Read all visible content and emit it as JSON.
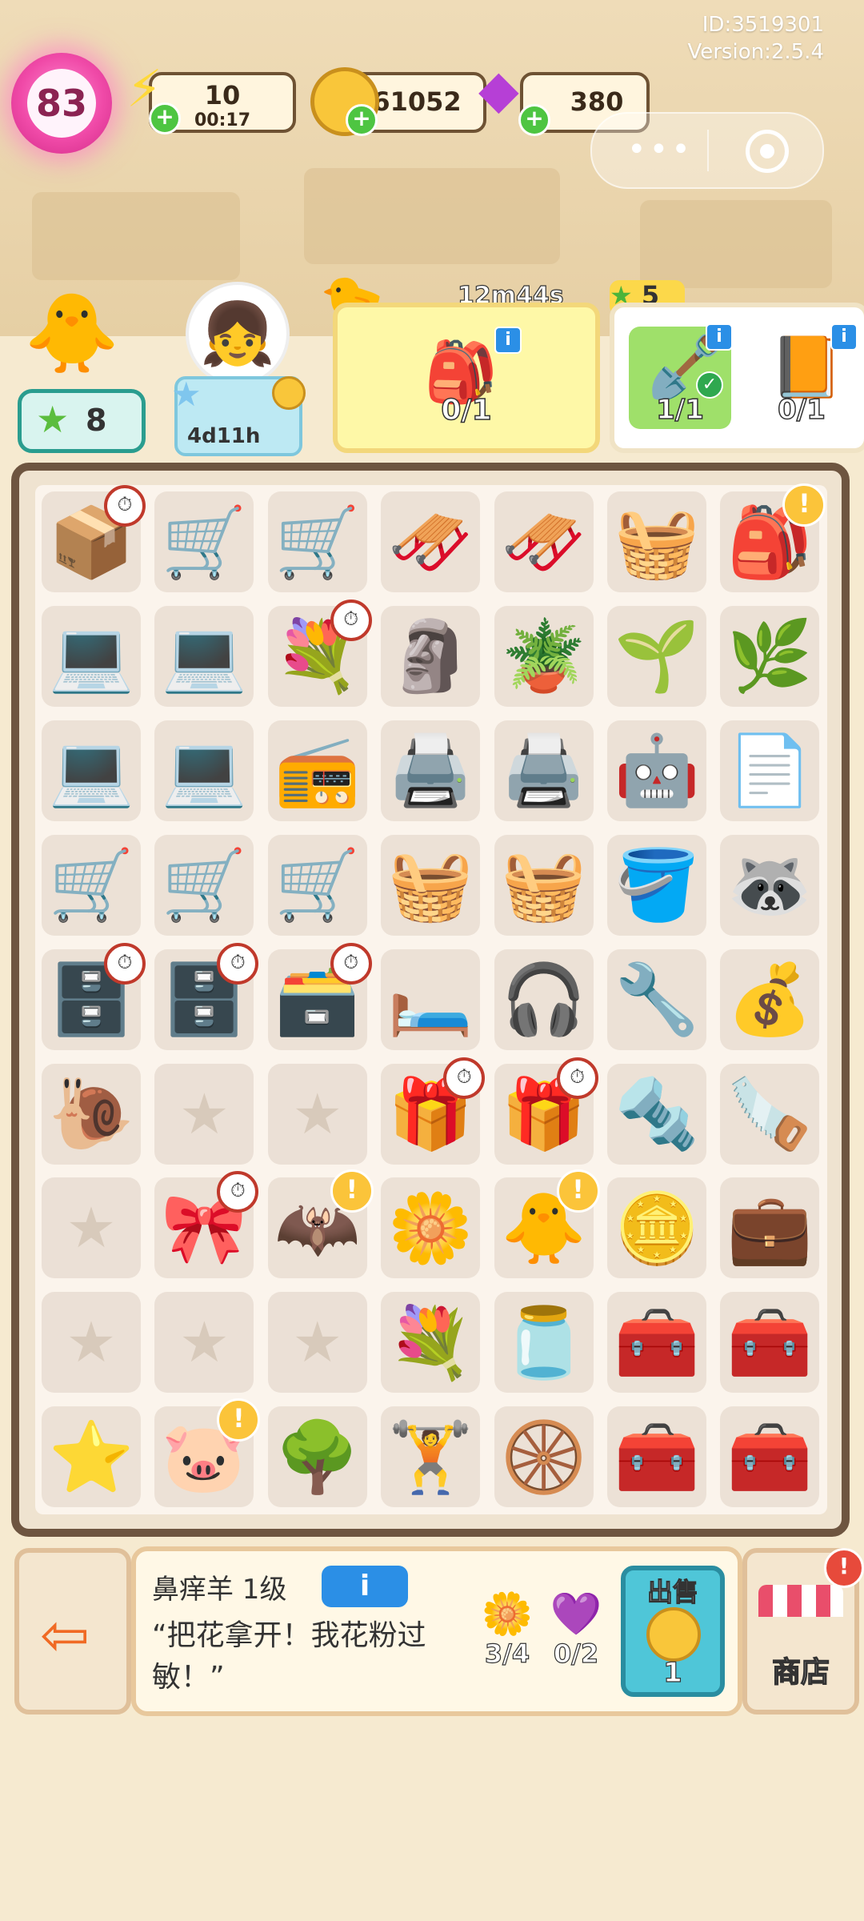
{
  "header": {
    "id": "ID:3519301",
    "version": "Version:2.5.4",
    "level": "83",
    "energy": {
      "value": "10",
      "timer": "00:17",
      "icon": "lightning-icon"
    },
    "coins": {
      "value": "61052",
      "icon": "coin-icon"
    },
    "gems": {
      "value": "380",
      "icon": "gem-icon"
    }
  },
  "characters": {
    "duck_stars": "8",
    "avatar_timer": "4d11h"
  },
  "orders": {
    "main": {
      "timer": "12m44s",
      "count": "0/1",
      "icon": "backpack-icon"
    },
    "stars": "5",
    "slots": [
      {
        "icon": "shovel-icon",
        "count": "1/1",
        "done": true
      },
      {
        "icon": "book-icon",
        "count": "0/1",
        "done": false
      }
    ]
  },
  "board": {
    "cells": [
      [
        "📦",
        "🛒",
        "🛒",
        "🛷",
        "🛷",
        "🧺",
        "🎒"
      ],
      [
        "💻",
        "💻",
        "💐",
        "🗿",
        "🪴",
        "🌱",
        "🌿"
      ],
      [
        "💻",
        "💻",
        "📻",
        "🖨️",
        "🖨️",
        "🤖",
        "📄"
      ],
      [
        "🛒",
        "🛒",
        "🛒",
        "🧺",
        "🧺",
        "🪣",
        "🦝"
      ],
      [
        "🗄️",
        "🗄️",
        "🗃️",
        "🛏️",
        "🎧",
        "🔧",
        "💰"
      ],
      [
        "🐌",
        "",
        "",
        "🎁",
        "🎁",
        "🔩",
        "🪚"
      ],
      [
        "",
        "🎀",
        "🦇",
        "🌼",
        "🐥",
        "🪙",
        "💼"
      ],
      [
        "",
        "",
        "",
        "💐",
        "🫙",
        "🧰",
        "🧰"
      ],
      [
        "⭐",
        "🐷",
        "🌳",
        "🏋️",
        "🛞",
        "🧰",
        "🧰"
      ]
    ],
    "timers": [
      "0-0",
      "0-0",
      "1-2",
      "4-0",
      "4-1",
      "4-2",
      "5-3",
      "5-4",
      "6-1"
    ],
    "alerts": [
      "0-6",
      "6-2",
      "6-4",
      "8-1"
    ]
  },
  "bottom": {
    "title": "鼻痒羊 1级",
    "info": "i",
    "quote": "“把花拿开！我花粉过敏！”",
    "needs": [
      {
        "icon": "flower-icon",
        "count": "3/4"
      },
      {
        "icon": "lavender-icon",
        "count": "0/2"
      }
    ],
    "sell_label": "出售",
    "sell_amount": "1",
    "shop_label": "商店"
  }
}
